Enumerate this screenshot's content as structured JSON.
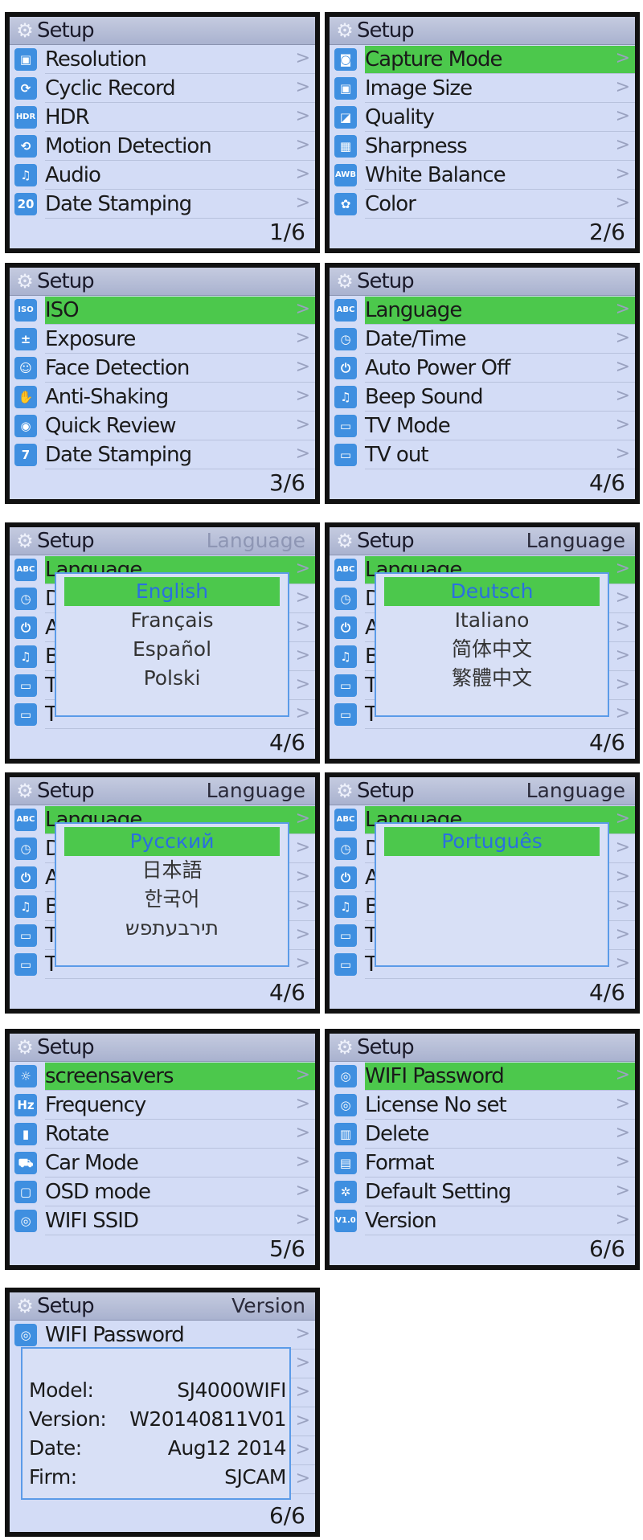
{
  "colors": {
    "selected": "#4cc84c",
    "icon": "#3f8fe0",
    "screen": "#d3dcf6",
    "popup_border": "#5b9be8",
    "option_selected_text": "#2a6fe0"
  },
  "header_label": "Setup",
  "chevron": ">",
  "panels": [
    {
      "page": "1/6",
      "selected": -1,
      "items": [
        {
          "label": "Resolution",
          "icon": "resolution-icon",
          "glyph": "▣"
        },
        {
          "label": "Cyclic Record",
          "icon": "cyclic-record-icon",
          "glyph": "⟳"
        },
        {
          "label": "HDR",
          "icon": "hdr-icon",
          "glyph": "HDR"
        },
        {
          "label": "Motion Detection",
          "icon": "motion-detection-icon",
          "glyph": "⟲"
        },
        {
          "label": "Audio",
          "icon": "music-note-icon",
          "glyph": "♫"
        },
        {
          "label": "Date Stamping",
          "icon": "calendar-icon",
          "glyph": "20"
        }
      ]
    },
    {
      "page": "2/6",
      "selected": 0,
      "items": [
        {
          "label": "Capture Mode",
          "icon": "camera-icon",
          "glyph": "◙"
        },
        {
          "label": "Image Size",
          "icon": "image-size-icon",
          "glyph": "▣"
        },
        {
          "label": "Quality",
          "icon": "quality-icon",
          "glyph": "◪"
        },
        {
          "label": "Sharpness",
          "icon": "sharpness-icon",
          "glyph": "▦"
        },
        {
          "label": "White Balance",
          "icon": "white-balance-icon",
          "glyph": "AWB"
        },
        {
          "label": "Color",
          "icon": "color-icon",
          "glyph": "✿"
        }
      ]
    },
    {
      "page": "3/6",
      "selected": 0,
      "items": [
        {
          "label": "ISO",
          "icon": "iso-icon",
          "glyph": "ISO"
        },
        {
          "label": "Exposure",
          "icon": "exposure-icon",
          "glyph": "±"
        },
        {
          "label": "Face Detection",
          "icon": "face-icon",
          "glyph": "☺"
        },
        {
          "label": "Anti-Shaking",
          "icon": "hand-icon",
          "glyph": "✋"
        },
        {
          "label": "Quick Review",
          "icon": "quick-review-icon",
          "glyph": "◉"
        },
        {
          "label": "Date Stamping",
          "icon": "calendar-icon",
          "glyph": "7"
        }
      ]
    },
    {
      "page": "4/6",
      "selected": 0,
      "items": [
        {
          "label": "Language",
          "icon": "language-icon",
          "glyph": "ABC"
        },
        {
          "label": "Date/Time",
          "icon": "clock-icon",
          "glyph": "◷"
        },
        {
          "label": "Auto Power Off",
          "icon": "power-icon",
          "glyph": "⏻"
        },
        {
          "label": "Beep Sound",
          "icon": "music-note-icon",
          "glyph": "♫"
        },
        {
          "label": "TV Mode",
          "icon": "tv-icon",
          "glyph": "▭"
        },
        {
          "label": "TV out",
          "icon": "tv-icon",
          "glyph": "▭"
        }
      ]
    },
    {
      "page": "4/6",
      "title": "Language",
      "title_dim": true,
      "selected": 0,
      "popup": [
        "English",
        "Français",
        "Español",
        "Polski"
      ],
      "items": [
        {
          "label": "Language",
          "icon": "language-icon",
          "glyph": "ABC"
        },
        {
          "label": "D",
          "icon": "clock-icon",
          "glyph": "◷"
        },
        {
          "label": "A",
          "icon": "power-icon",
          "glyph": "⏻"
        },
        {
          "label": "B",
          "icon": "music-note-icon",
          "glyph": "♫"
        },
        {
          "label": "T",
          "icon": "tv-icon",
          "glyph": "▭"
        },
        {
          "label": "T",
          "icon": "tv-icon",
          "glyph": "▭"
        }
      ]
    },
    {
      "page": "4/6",
      "title": "Language",
      "selected": 0,
      "popup": [
        "Deutsch",
        "Italiano",
        "简体中文",
        "繁體中文"
      ],
      "items": [
        {
          "label": "Language",
          "icon": "language-icon",
          "glyph": "ABC"
        },
        {
          "label": "D",
          "icon": "clock-icon",
          "glyph": "◷"
        },
        {
          "label": "A",
          "icon": "power-icon",
          "glyph": "⏻"
        },
        {
          "label": "B",
          "icon": "music-note-icon",
          "glyph": "♫"
        },
        {
          "label": "T",
          "icon": "tv-icon",
          "glyph": "▭"
        },
        {
          "label": "T",
          "icon": "tv-icon",
          "glyph": "▭"
        }
      ]
    },
    {
      "page": "4/6",
      "title": "Language",
      "selected": 0,
      "popup": [
        "Русский",
        "日本語",
        "한국어",
        "תירבעתפש"
      ],
      "items": [
        {
          "label": "Language",
          "icon": "language-icon",
          "glyph": "ABC"
        },
        {
          "label": "D",
          "icon": "clock-icon",
          "glyph": "◷"
        },
        {
          "label": "A",
          "icon": "power-icon",
          "glyph": "⏻"
        },
        {
          "label": "B",
          "icon": "music-note-icon",
          "glyph": "♫"
        },
        {
          "label": "T",
          "icon": "tv-icon",
          "glyph": "▭"
        },
        {
          "label": "T",
          "icon": "tv-icon",
          "glyph": "▭"
        }
      ]
    },
    {
      "page": "4/6",
      "title": "Language",
      "selected": 0,
      "popup": [
        "Português"
      ],
      "items": [
        {
          "label": "Language",
          "icon": "language-icon",
          "glyph": "ABC"
        },
        {
          "label": "D",
          "icon": "clock-icon",
          "glyph": "◷"
        },
        {
          "label": "A",
          "icon": "power-icon",
          "glyph": "⏻"
        },
        {
          "label": "B",
          "icon": "music-note-icon",
          "glyph": "♫"
        },
        {
          "label": "T",
          "icon": "tv-icon",
          "glyph": "▭"
        },
        {
          "label": "T",
          "icon": "tv-icon",
          "glyph": "▭"
        }
      ]
    },
    {
      "page": "5/6",
      "selected": 0,
      "items": [
        {
          "label": "screensavers",
          "icon": "sun-icon",
          "glyph": "☼"
        },
        {
          "label": "Frequency",
          "icon": "frequency-icon",
          "glyph": "Hz"
        },
        {
          "label": "Rotate",
          "icon": "rotate-icon",
          "glyph": "▮"
        },
        {
          "label": "Car Mode",
          "icon": "car-icon",
          "glyph": "⛟"
        },
        {
          "label": "OSD mode",
          "icon": "osd-icon",
          "glyph": "▢"
        },
        {
          "label": "WIFI SSID",
          "icon": "wifi-icon",
          "glyph": "◎"
        }
      ]
    },
    {
      "page": "6/6",
      "selected": 0,
      "items": [
        {
          "label": "WIFI Password",
          "icon": "wifi-icon",
          "glyph": "◎"
        },
        {
          "label": "License No set",
          "icon": "license-icon",
          "glyph": "◎"
        },
        {
          "label": "Delete",
          "icon": "delete-icon",
          "glyph": "▥"
        },
        {
          "label": "Format",
          "icon": "format-icon",
          "glyph": "▤"
        },
        {
          "label": "Default Setting",
          "icon": "gear-icon",
          "glyph": "✲"
        },
        {
          "label": "Version",
          "icon": "version-icon",
          "glyph": "V1.0"
        }
      ]
    },
    {
      "page": "6/6",
      "title": "Version",
      "selected": -1,
      "version": [
        {
          "key": "Model:",
          "value": "SJ4000WIFI"
        },
        {
          "key": "Version:",
          "value": "W20140811V01"
        },
        {
          "key": "Date:",
          "value": "Aug12 2014"
        },
        {
          "key": "Firm:",
          "value": "SJCAM"
        }
      ],
      "items": [
        {
          "label": "WIFI Password",
          "icon": "wifi-icon",
          "glyph": "◎"
        },
        {
          "label": "",
          "icon": "license-icon",
          "glyph": ""
        },
        {
          "label": "",
          "icon": "delete-icon",
          "glyph": ""
        },
        {
          "label": "",
          "icon": "format-icon",
          "glyph": ""
        },
        {
          "label": "",
          "icon": "gear-icon",
          "glyph": ""
        },
        {
          "label": "",
          "icon": "version-icon",
          "glyph": ""
        }
      ]
    }
  ]
}
